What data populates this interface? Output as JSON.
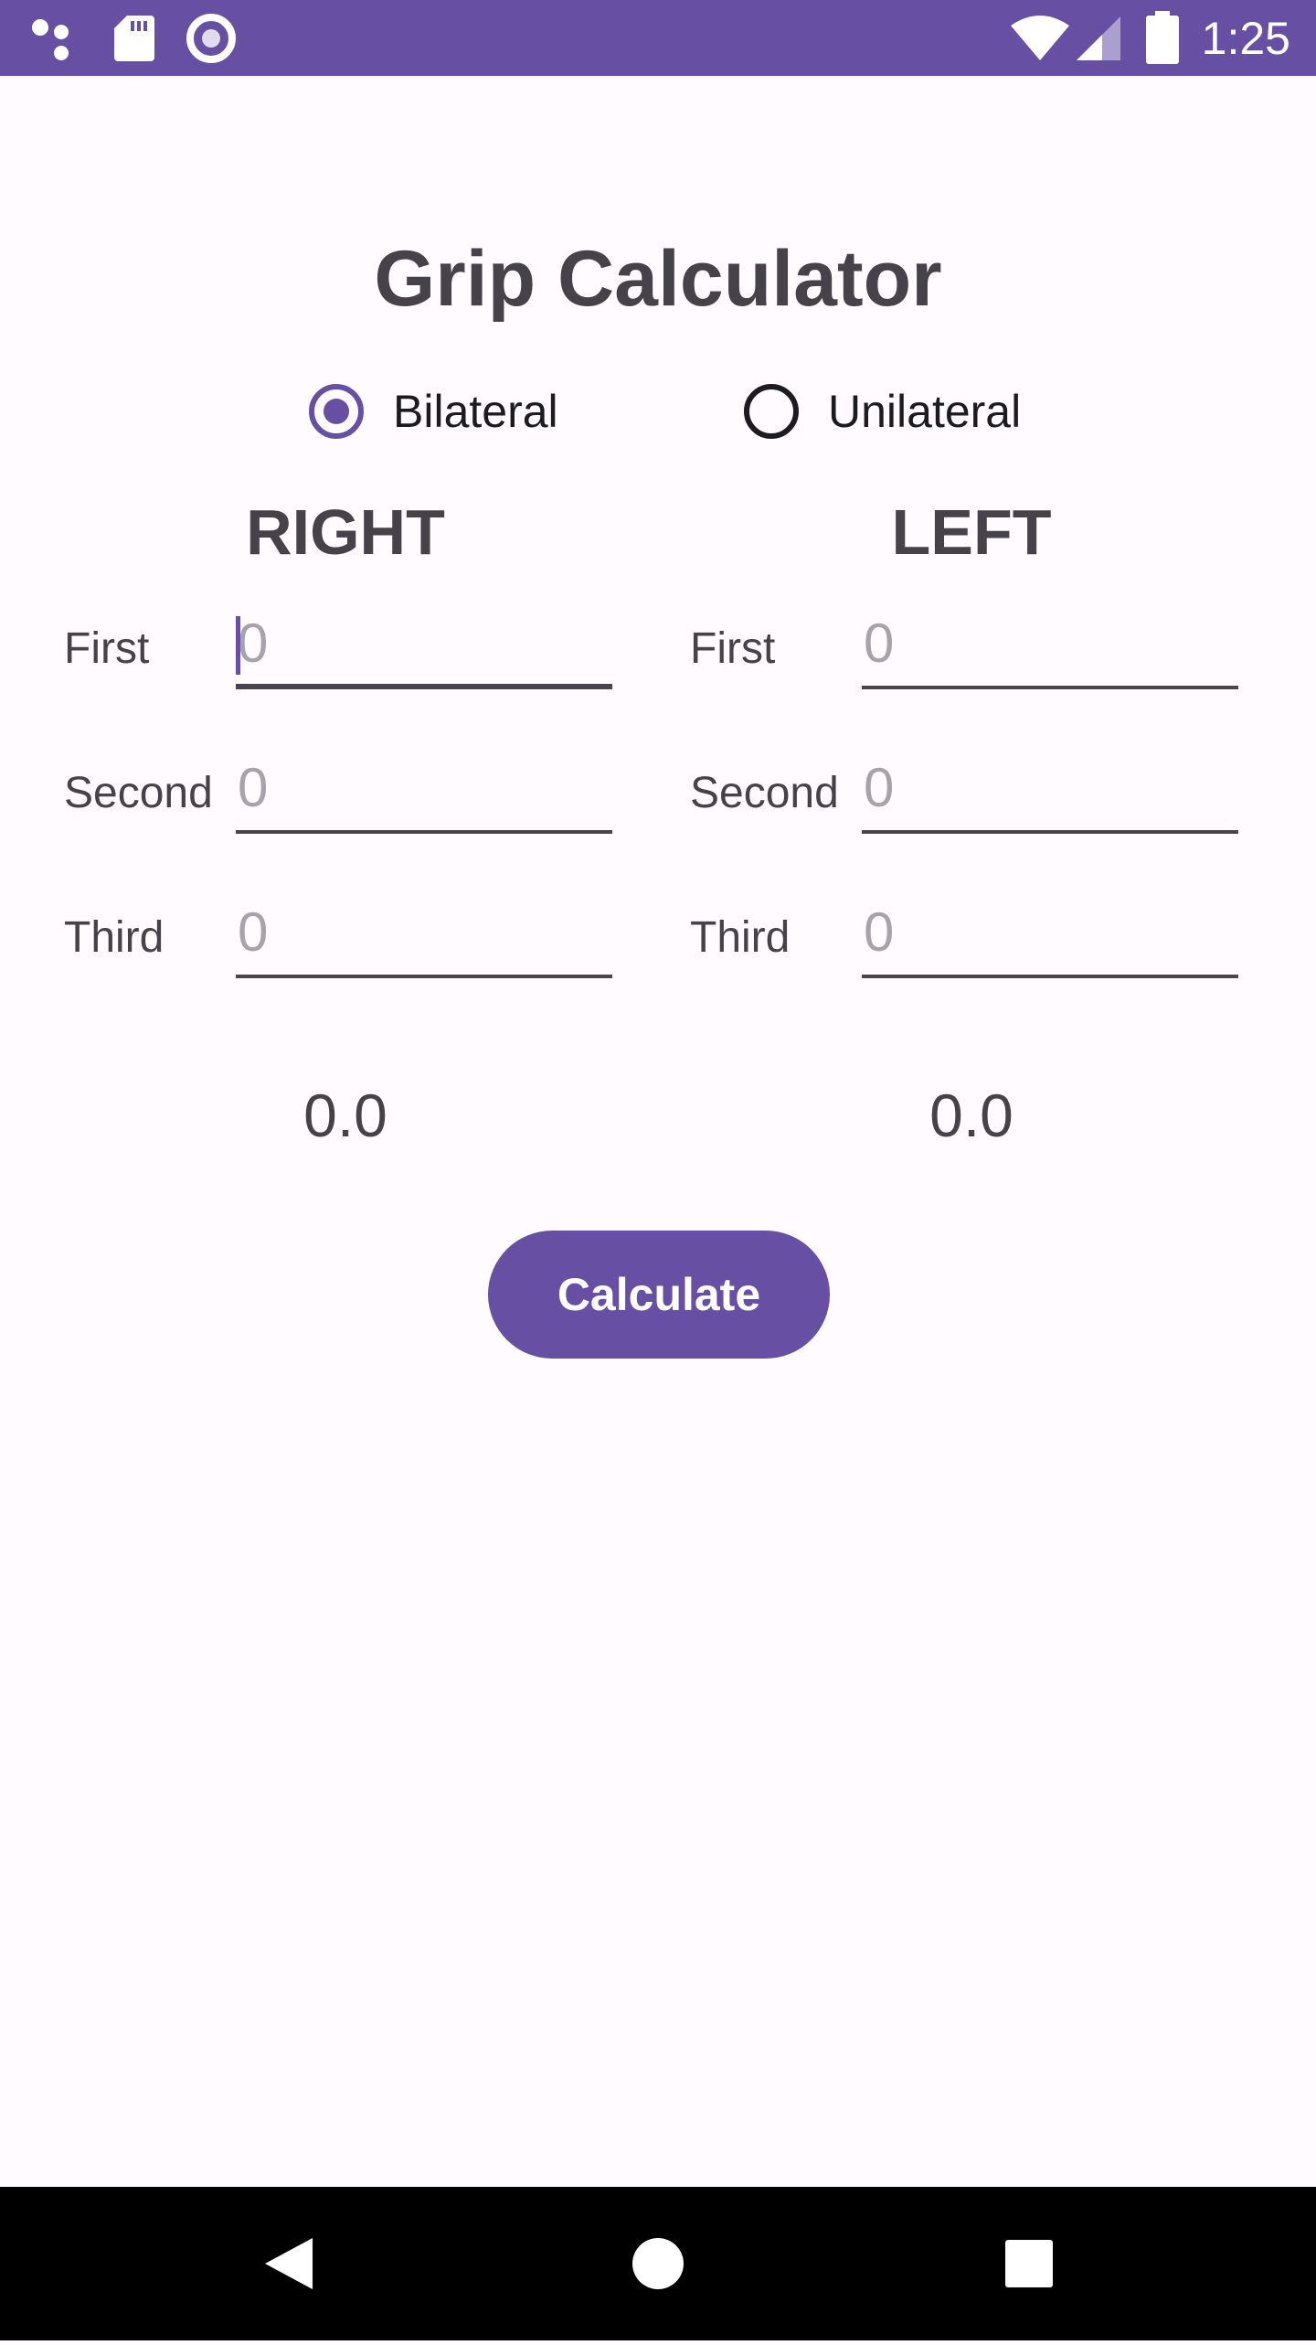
{
  "status_bar": {
    "time": "1:25",
    "icons_left": [
      "assistant-dots-icon",
      "sd-card-icon",
      "record-icon"
    ],
    "icons_right": [
      "wifi-icon",
      "cell-signal-icon",
      "battery-icon"
    ]
  },
  "app": {
    "title": "Grip Calculator",
    "mode": {
      "options": [
        {
          "label": "Bilateral",
          "selected": true
        },
        {
          "label": "Unilateral",
          "selected": false
        }
      ]
    },
    "right": {
      "header": "RIGHT",
      "rows": [
        {
          "label": "First",
          "placeholder": "0"
        },
        {
          "label": "Second",
          "placeholder": "0"
        },
        {
          "label": "Third",
          "placeholder": "0"
        }
      ],
      "result": "0.0"
    },
    "left": {
      "header": "LEFT",
      "rows": [
        {
          "label": "First",
          "placeholder": "0"
        },
        {
          "label": "Second",
          "placeholder": "0"
        },
        {
          "label": "Third",
          "placeholder": "0"
        }
      ],
      "result": "0.0"
    },
    "calculate_label": "Calculate"
  },
  "colors": {
    "primary": "#6750a4",
    "background": "#fffbfe",
    "text": "#45424a"
  },
  "nav_bar": {
    "buttons": [
      "back-icon",
      "home-icon",
      "recents-icon"
    ]
  }
}
